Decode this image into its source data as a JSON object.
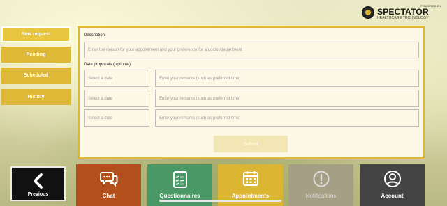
{
  "brand": {
    "powered_by": "POWERED BY",
    "name": "SPECTATOR",
    "subtitle": "HEALTHCARE TECHNOLOGY"
  },
  "sidemenu": {
    "items": [
      {
        "label": "New request",
        "active": true
      },
      {
        "label": "Pending",
        "active": false
      },
      {
        "label": "Scheduled",
        "active": false
      },
      {
        "label": "History",
        "active": false
      }
    ]
  },
  "form": {
    "description_label": "Description:",
    "description_placeholder": "Enter the reason for your appointment and your preference for a doctor/department",
    "dates_label": "Date proposals (optional):",
    "rows": [
      {
        "date_placeholder": "Select a date",
        "remarks_placeholder": "Enter your remarks (such as preferred time)"
      },
      {
        "date_placeholder": "Select a date",
        "remarks_placeholder": "Enter your remarks (such as preferred time)"
      },
      {
        "date_placeholder": "Select a date",
        "remarks_placeholder": "Enter your remarks (such as preferred time)"
      }
    ],
    "submit_label": "Submit"
  },
  "previous": {
    "label": "Previous"
  },
  "bottom_nav": {
    "items": [
      {
        "label": "Chat",
        "icon": "chat-icon",
        "color": "#b24f1c"
      },
      {
        "label": "Questionnaires",
        "icon": "clipboard-icon",
        "color": "#4a9865"
      },
      {
        "label": "Appointments",
        "icon": "calendar-icon",
        "color": "#dcb633"
      },
      {
        "label": "Notifications",
        "icon": "alert-icon",
        "color": "#a59f85",
        "disabled": true
      },
      {
        "label": "Account",
        "icon": "user-icon",
        "color": "#444444"
      }
    ]
  }
}
